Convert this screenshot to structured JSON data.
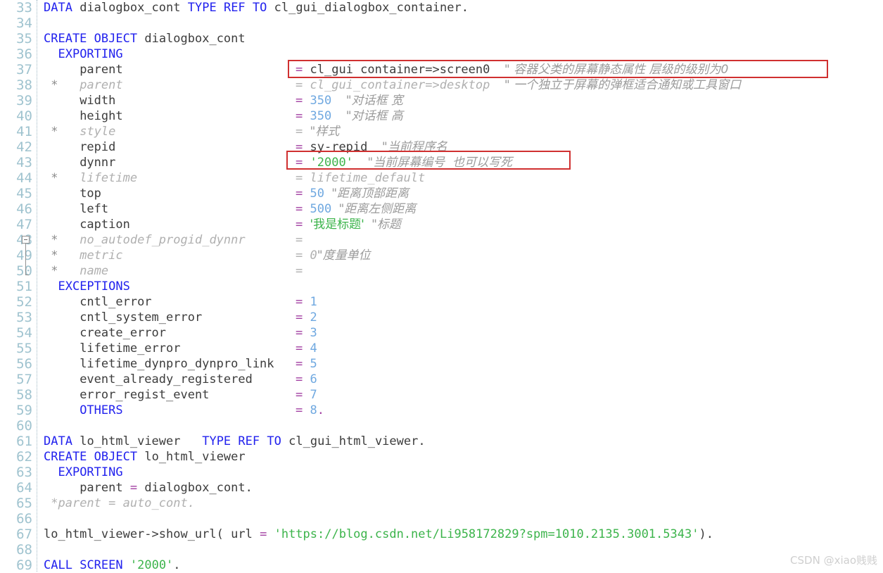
{
  "editor": {
    "language": "ABAP",
    "first_line_number": 33,
    "last_line_number": 69,
    "colors": {
      "background": "#ffffff",
      "keyword": "#2222ee",
      "identifier": "#3c3c3c",
      "number": "#6fa8e0",
      "string": "#3cb44b",
      "operator": "#a23fa2",
      "comment": "#9b9b9b",
      "commented_out": "#b0b0b0",
      "line_number": "#9fc3cf",
      "annotation_box": "#d03030"
    }
  },
  "watermark": {
    "text": "CSDN @xiao贱贱"
  },
  "lines": [
    {
      "n": "33",
      "text": "DATA dialogbox_cont TYPE REF TO cl_gui_dialogbox_container."
    },
    {
      "n": "34",
      "text": ""
    },
    {
      "n": "35",
      "text": "CREATE OBJECT dialogbox_cont"
    },
    {
      "n": "36",
      "text": "  EXPORTING"
    },
    {
      "n": "37",
      "text": "     parent                      = cl_gui_container=>screen0  \" 容器父类的屏幕静态属性 层级的级别为0"
    },
    {
      "n": "38",
      "text": "*    parent                      = cl_gui_container=>desktop  \" 一个独立于屏幕的弹框适合通知或工具窗口"
    },
    {
      "n": "39",
      "text": "     width                       = 350  \"对话框 宽"
    },
    {
      "n": "40",
      "text": "     height                      = 350  \"对话框 高"
    },
    {
      "n": "41",
      "text": "*    style                       = \"样式"
    },
    {
      "n": "42",
      "text": "     repid                       = sy-repid  \"当前程序名"
    },
    {
      "n": "43",
      "text": "     dynnr                       = '2000'  \"当前屏幕编号  也可以写死"
    },
    {
      "n": "44",
      "text": "*    lifetime                    = lifetime_default"
    },
    {
      "n": "45",
      "text": "     top                         = 50  \"距离顶部距离"
    },
    {
      "n": "46",
      "text": "     left                        = 500  \"距离左侧距离"
    },
    {
      "n": "47",
      "text": "     caption                     = '我是标题'  \"标题"
    },
    {
      "n": "48",
      "text": "*    no_autodef_progid_dynnr     ="
    },
    {
      "n": "49",
      "text": "*    metric                      = 0\"度量单位"
    },
    {
      "n": "50",
      "text": "*    name                        ="
    },
    {
      "n": "51",
      "text": "  EXCEPTIONS"
    },
    {
      "n": "52",
      "text": "     cntl_error                  = 1"
    },
    {
      "n": "53",
      "text": "     cntl_system_error           = 2"
    },
    {
      "n": "54",
      "text": "     create_error                = 3"
    },
    {
      "n": "55",
      "text": "     lifetime_error              = 4"
    },
    {
      "n": "56",
      "text": "     lifetime_dynpro_dynpro_link = 5"
    },
    {
      "n": "57",
      "text": "     event_already_registered    = 6"
    },
    {
      "n": "58",
      "text": "     error_regist_event          = 7"
    },
    {
      "n": "59",
      "text": "     OTHERS                      = 8."
    },
    {
      "n": "60",
      "text": ""
    },
    {
      "n": "61",
      "text": "DATA lo_html_viewer   TYPE REF TO cl_gui_html_viewer."
    },
    {
      "n": "62",
      "text": "CREATE OBJECT lo_html_viewer"
    },
    {
      "n": "63",
      "text": "  EXPORTING"
    },
    {
      "n": "64",
      "text": "     parent = dialogbox_cont."
    },
    {
      "n": "65",
      "text": "*parent = auto_cont."
    },
    {
      "n": "66",
      "text": ""
    },
    {
      "n": "67",
      "text": "lo_html_viewer->show_url( url = 'https://blog.csdn.net/Li958172829?spm=1010.2135.3001.5343')."
    },
    {
      "n": "68",
      "text": ""
    },
    {
      "n": "69",
      "text": "CALL SCREEN '2000'."
    }
  ],
  "tokens": {
    "l33": {
      "kw1": "DATA",
      "ident1": "dialogbox_cont",
      "kw2": "TYPE",
      "kw3": "REF",
      "kw4": "TO",
      "ident2": "cl_gui_dialogbox_container",
      "dot": "."
    },
    "l35": {
      "kw1": "CREATE",
      "kw2": "OBJECT",
      "ident1": "dialogbox_cont"
    },
    "l36": {
      "kw": "EXPORTING"
    },
    "l37": {
      "name": "parent",
      "op": "=",
      "value": "cl_gui container=>screen0",
      "comment": "\" 容器父类的屏幕静态属性 层级的级别为0"
    },
    "l38": {
      "star": "*",
      "name": "parent",
      "op": "=",
      "value": "cl_gui_container=>desktop",
      "comment": "\" 一个独立于屏幕的弹框适合通知或工具窗口"
    },
    "l39": {
      "name": "width",
      "op": "=",
      "value": "350",
      "comment": "\"对话框 宽"
    },
    "l40": {
      "name": "height",
      "op": "=",
      "value": "350",
      "comment": "\"对话框 高"
    },
    "l41": {
      "star": "*",
      "name": "style",
      "op": "=",
      "comment": "\"样式"
    },
    "l42": {
      "name": "repid",
      "op": "=",
      "value": "sy-repid",
      "comment": "\"当前程序名"
    },
    "l43": {
      "name": "dynnr",
      "op": "=",
      "value": "'2000'",
      "comment": "\"当前屏幕编号  也可以写死"
    },
    "l44": {
      "star": "*",
      "name": "lifetime",
      "op": "=",
      "value": "lifetime_default"
    },
    "l45": {
      "name": "top",
      "op": "=",
      "value": "50",
      "comment": "\"距离顶部距离"
    },
    "l46": {
      "name": "left",
      "op": "=",
      "value": "500",
      "comment": "\"距离左侧距离"
    },
    "l47": {
      "name": "caption",
      "op": "=",
      "value": "'我是标题'",
      "comment": "\"标题"
    },
    "l48": {
      "star": "*",
      "name": "no_autodef_progid_dynnr",
      "op": "="
    },
    "l49": {
      "star": "*",
      "name": "metric",
      "op": "=",
      "value": "0",
      "comment": "\"度量单位"
    },
    "l50": {
      "star": "*",
      "name": "name",
      "op": "="
    },
    "l51": {
      "kw": "EXCEPTIONS"
    },
    "l52": {
      "name": "cntl_error",
      "op": "=",
      "value": "1"
    },
    "l53": {
      "name": "cntl_system_error",
      "op": "=",
      "value": "2"
    },
    "l54": {
      "name": "create_error",
      "op": "=",
      "value": "3"
    },
    "l55": {
      "name": "lifetime_error",
      "op": "=",
      "value": "4"
    },
    "l56": {
      "name": "lifetime_dynpro_dynpro_link",
      "op": "=",
      "value": "5"
    },
    "l57": {
      "name": "event_already_registered",
      "op": "=",
      "value": "6"
    },
    "l58": {
      "name": "error_regist_event",
      "op": "=",
      "value": "7"
    },
    "l59": {
      "name": "OTHERS",
      "op": "=",
      "value": "8",
      "dot": "."
    },
    "l61": {
      "kw1": "DATA",
      "ident1": "lo_html_viewer",
      "kw2": "TYPE",
      "kw3": "REF",
      "kw4": "TO",
      "ident2": "cl_gui_html_viewer",
      "dot": "."
    },
    "l62": {
      "kw1": "CREATE",
      "kw2": "OBJECT",
      "ident1": "lo_html_viewer"
    },
    "l63": {
      "kw": "EXPORTING"
    },
    "l64": {
      "name": "parent",
      "op": "=",
      "value": "dialogbox_cont",
      "dot": "."
    },
    "l65": {
      "text": "*parent = auto_cont."
    },
    "l67": {
      "ident": "lo_html_viewer->show_url(",
      "arg": "url",
      "op": "=",
      "url": "'https://blog.csdn.net/Li958172829?spm=1010.2135.3001.5343'",
      "close": ")",
      "dot": "."
    },
    "l69": {
      "kw1": "CALL",
      "kw2": "SCREEN",
      "value": "'2000'",
      "dot": "."
    }
  },
  "annotations": [
    {
      "id": "box-line-37",
      "label": "highlight-parent-screen0"
    },
    {
      "id": "box-line-43",
      "label": "highlight-dynnr-2000"
    }
  ],
  "fold": {
    "marker_line": "48",
    "span_lines": [
      "48",
      "49",
      "50"
    ]
  }
}
